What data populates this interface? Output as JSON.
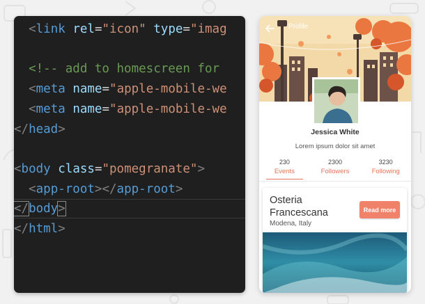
{
  "editor": {
    "lines": [
      {
        "tokens": [
          [
            "plain",
            "  "
          ],
          [
            "punct",
            "<"
          ],
          [
            "tag",
            "link"
          ],
          [
            "plain",
            " "
          ],
          [
            "attr",
            "rel"
          ],
          [
            "plain",
            "="
          ],
          [
            "str",
            "\"icon\""
          ],
          [
            "plain",
            " "
          ],
          [
            "attr",
            "type"
          ],
          [
            "plain",
            "="
          ],
          [
            "str",
            "\"imag"
          ]
        ]
      },
      {
        "tokens": []
      },
      {
        "tokens": [
          [
            "plain",
            "  "
          ],
          [
            "comment",
            "<!-- add to homescreen for"
          ]
        ]
      },
      {
        "tokens": [
          [
            "plain",
            "  "
          ],
          [
            "punct",
            "<"
          ],
          [
            "tag",
            "meta"
          ],
          [
            "plain",
            " "
          ],
          [
            "attr",
            "name"
          ],
          [
            "plain",
            "="
          ],
          [
            "str",
            "\"apple-mobile-we"
          ]
        ]
      },
      {
        "tokens": [
          [
            "plain",
            "  "
          ],
          [
            "punct",
            "<"
          ],
          [
            "tag",
            "meta"
          ],
          [
            "plain",
            " "
          ],
          [
            "attr",
            "name"
          ],
          [
            "plain",
            "="
          ],
          [
            "str",
            "\"apple-mobile-we"
          ]
        ]
      },
      {
        "tokens": [
          [
            "punct",
            "</"
          ],
          [
            "tag",
            "head"
          ],
          [
            "punct",
            ">"
          ]
        ]
      },
      {
        "tokens": []
      },
      {
        "tokens": [
          [
            "punct",
            "<"
          ],
          [
            "tag",
            "body"
          ],
          [
            "plain",
            " "
          ],
          [
            "attr",
            "class"
          ],
          [
            "plain",
            "="
          ],
          [
            "str",
            "\"pomegranate\""
          ],
          [
            "punct",
            ">"
          ]
        ]
      },
      {
        "tokens": [
          [
            "plain",
            "  "
          ],
          [
            "punct",
            "<"
          ],
          [
            "tag",
            "app-root"
          ],
          [
            "punct",
            "></"
          ],
          [
            "tag",
            "app-root"
          ],
          [
            "punct",
            ">"
          ]
        ]
      },
      {
        "tokens": [
          [
            "punct",
            "</"
          ],
          [
            "tag",
            "body"
          ],
          [
            "punct",
            ">"
          ]
        ],
        "active": true
      },
      {
        "tokens": [
          [
            "punct",
            "</"
          ],
          [
            "tag",
            "html"
          ],
          [
            "punct",
            ">"
          ]
        ]
      }
    ]
  },
  "profile": {
    "hero_title": "Profile",
    "name": "Jessica White",
    "bio": "Lorem ipsum dolor sit amet",
    "stats": [
      {
        "count": "230",
        "label": "Events",
        "active": true
      },
      {
        "count": "2300",
        "label": "Followers",
        "active": false
      },
      {
        "count": "3230",
        "label": "Following",
        "active": false
      }
    ]
  },
  "card": {
    "title": "Osteria Francescana",
    "subtitle": "Modena, Italy",
    "button": "Read more"
  },
  "colors": {
    "accent": "#e57355",
    "button": "#ef8268",
    "editor_bg": "#1f1f1f"
  },
  "icons": {
    "back": "arrow-left-icon"
  }
}
